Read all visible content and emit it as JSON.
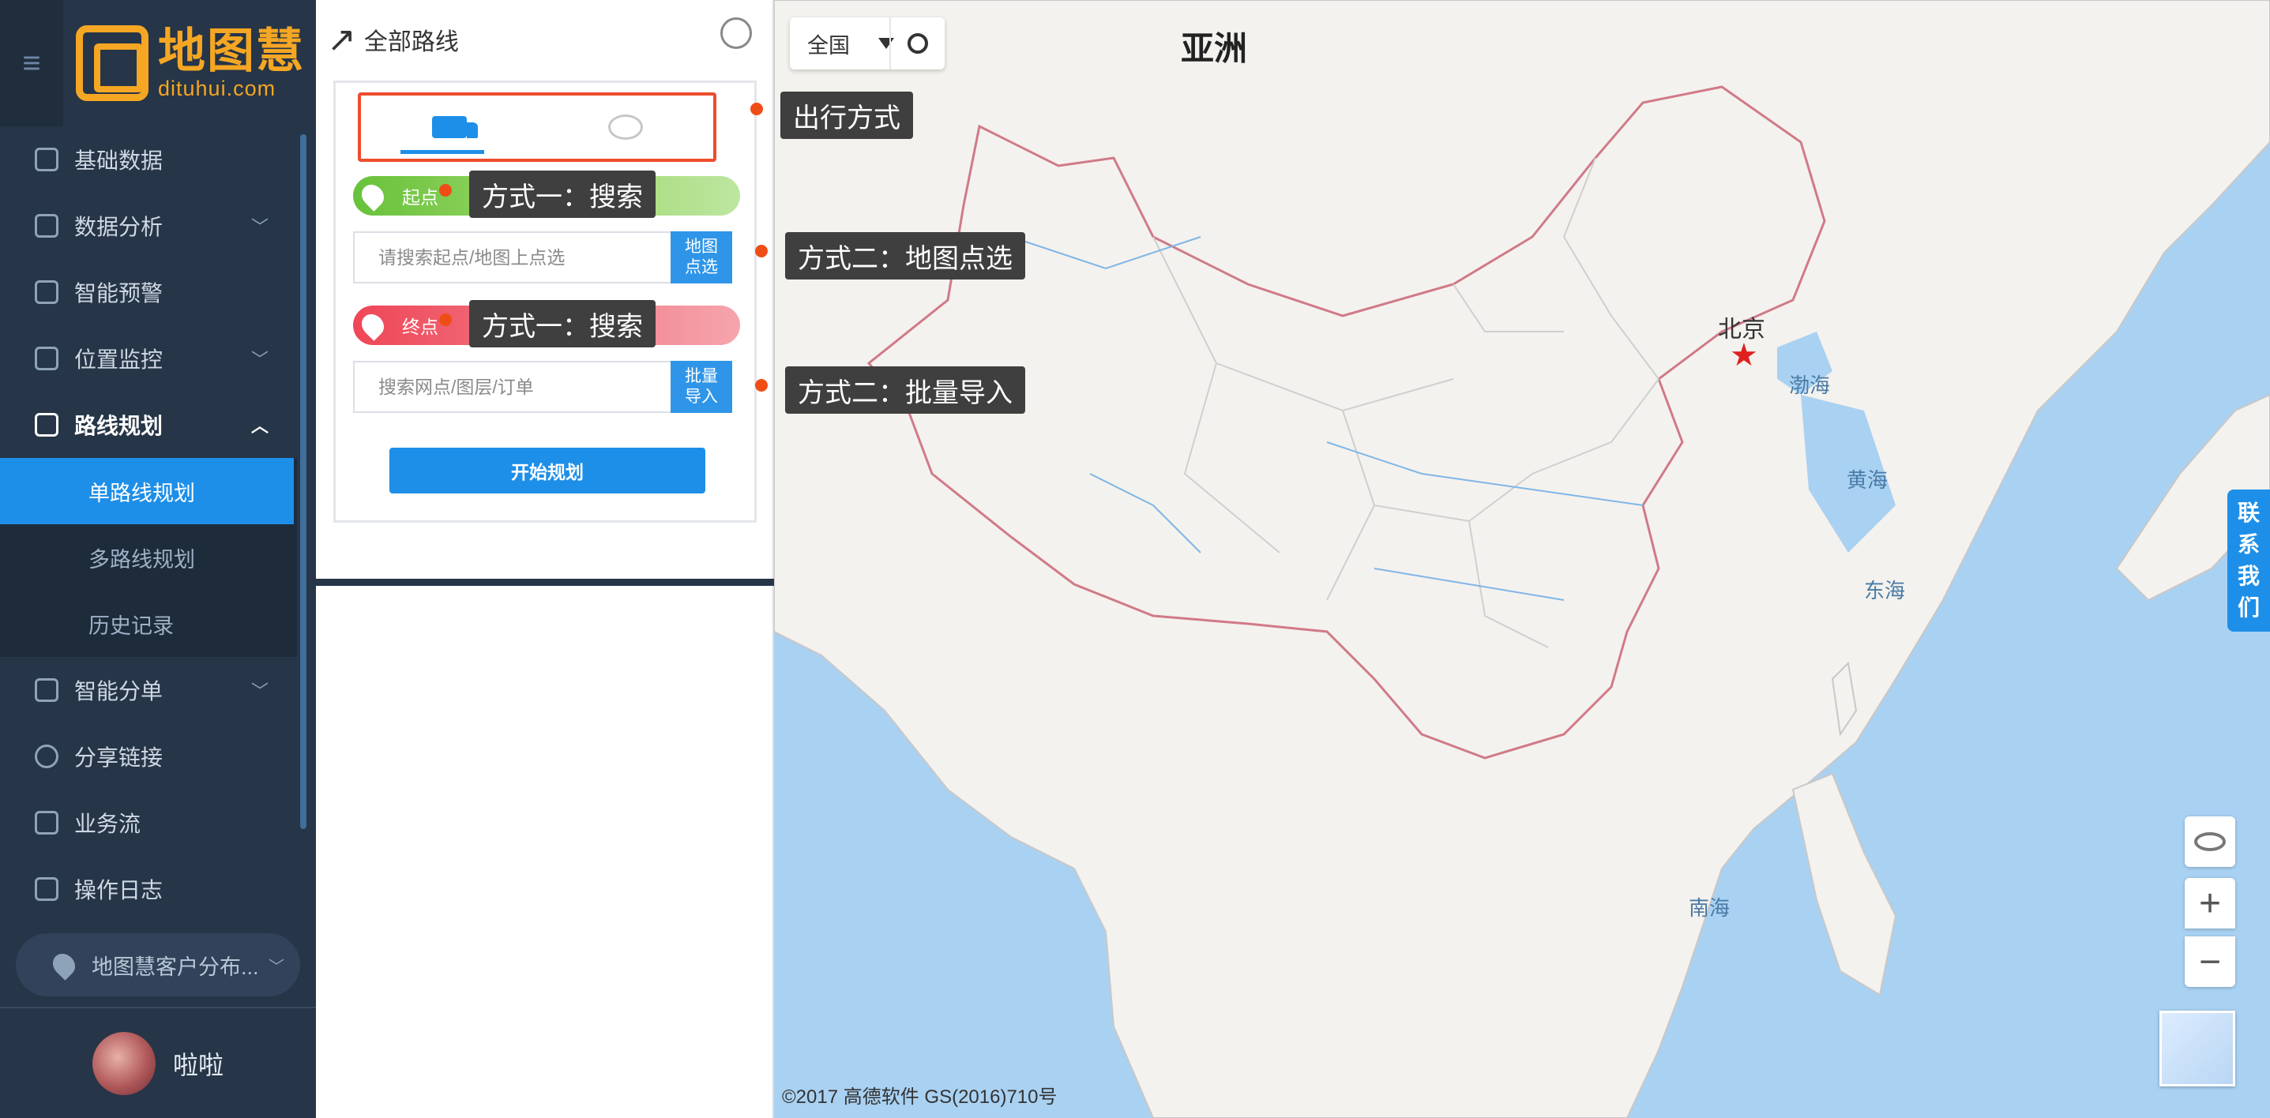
{
  "brand": {
    "name_cn": "地图慧",
    "domain": "dituhui.com"
  },
  "sidebar": {
    "items": [
      {
        "label": "基础数据",
        "icon": "database-icon",
        "has_chevron": false
      },
      {
        "label": "数据分析",
        "icon": "chart-icon",
        "has_chevron": true
      },
      {
        "label": "智能预警",
        "icon": "alert-icon",
        "has_chevron": false
      },
      {
        "label": "位置监控",
        "icon": "location-icon",
        "has_chevron": true
      },
      {
        "label": "路线规划",
        "icon": "route-icon",
        "has_chevron": true,
        "expanded": true
      },
      {
        "label": "智能分单",
        "icon": "order-icon",
        "has_chevron": true
      },
      {
        "label": "分享链接",
        "icon": "share-icon",
        "has_chevron": false
      },
      {
        "label": "业务流",
        "icon": "flow-icon",
        "has_chevron": false
      },
      {
        "label": "操作日志",
        "icon": "calendar-icon",
        "has_chevron": false
      }
    ],
    "subitems": [
      "单路线规划",
      "多路线规划",
      "历史记录"
    ],
    "selected_subitem": "单路线规划",
    "customer_selector": "地图慧客户分布...",
    "user_name": "啦啦"
  },
  "panel": {
    "title": "全部路线",
    "start_label": "起点",
    "start_placeholder": "请搜索起点/地图上点选",
    "start_button": "地图点选",
    "end_label": "终点",
    "end_placeholder": "搜索网点/图层/订单",
    "end_button": "批量导入",
    "plan_button": "开始规划"
  },
  "callouts": {
    "travel_mode": "出行方式",
    "start_search": "方式一：搜索",
    "start_map_pick": "方式二：地图点选",
    "end_search": "方式一：搜索",
    "end_batch_import": "方式二：批量导入"
  },
  "map": {
    "region": "全国",
    "continent": "亚洲",
    "city": "北京",
    "seas": [
      "渤海",
      "黄海",
      "东海",
      "南海"
    ],
    "contact": [
      "联",
      "系",
      "我",
      "们"
    ],
    "copyright": "©2017 高德软件 GS(2016)710号"
  },
  "colors": {
    "accent": "#1e8fe8",
    "sidebar": "#263547",
    "callout": "#3f3f3f",
    "highlight": "#ee4c2c",
    "start": "#68c23a",
    "end": "#ef4657"
  }
}
